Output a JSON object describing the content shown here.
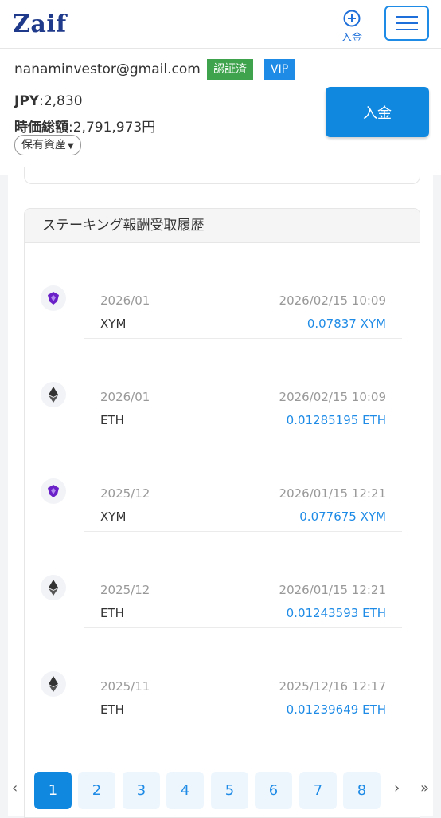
{
  "header": {
    "logo": "Zaif",
    "deposit_label": "入金"
  },
  "account": {
    "email": "nanaminvestor@gmail.com",
    "verified_badge": "認証済",
    "vip_badge": "VIP",
    "jpy_label": "JPY",
    "jpy_value": ":2,830",
    "total_label": "時価総額",
    "total_value": ":2,791,973円",
    "assets_button": "保有資産",
    "deposit_button": "入金"
  },
  "staking": {
    "title": "ステーキング報酬受取履歴",
    "rows": [
      {
        "icon": "xym-icon",
        "period": "2026/01",
        "currency": "XYM",
        "datetime": "2026/02/15 10:09",
        "amount": "0.07837 XYM"
      },
      {
        "icon": "eth-icon",
        "period": "2026/01",
        "currency": "ETH",
        "datetime": "2026/02/15 10:09",
        "amount": "0.01285195 ETH"
      },
      {
        "icon": "xym-icon",
        "period": "2025/12",
        "currency": "XYM",
        "datetime": "2026/01/15 12:21",
        "amount": "0.077675 XYM"
      },
      {
        "icon": "eth-icon",
        "period": "2025/12",
        "currency": "ETH",
        "datetime": "2026/01/15 12:21",
        "amount": "0.01243593 ETH"
      },
      {
        "icon": "eth-icon",
        "period": "2025/11",
        "currency": "ETH",
        "datetime": "2025/12/16 12:17",
        "amount": "0.01239649 ETH"
      }
    ]
  },
  "pagination": {
    "prev": "‹",
    "pages": [
      "1",
      "2",
      "3",
      "4",
      "5",
      "6",
      "7",
      "8"
    ],
    "active_page": "1",
    "next": "›",
    "last": "»"
  },
  "colors": {
    "accent": "#1188e0",
    "link": "#1e8be6",
    "verified": "#3fa34d",
    "brand": "#1f3a8a",
    "xym": "#6b21c8"
  }
}
